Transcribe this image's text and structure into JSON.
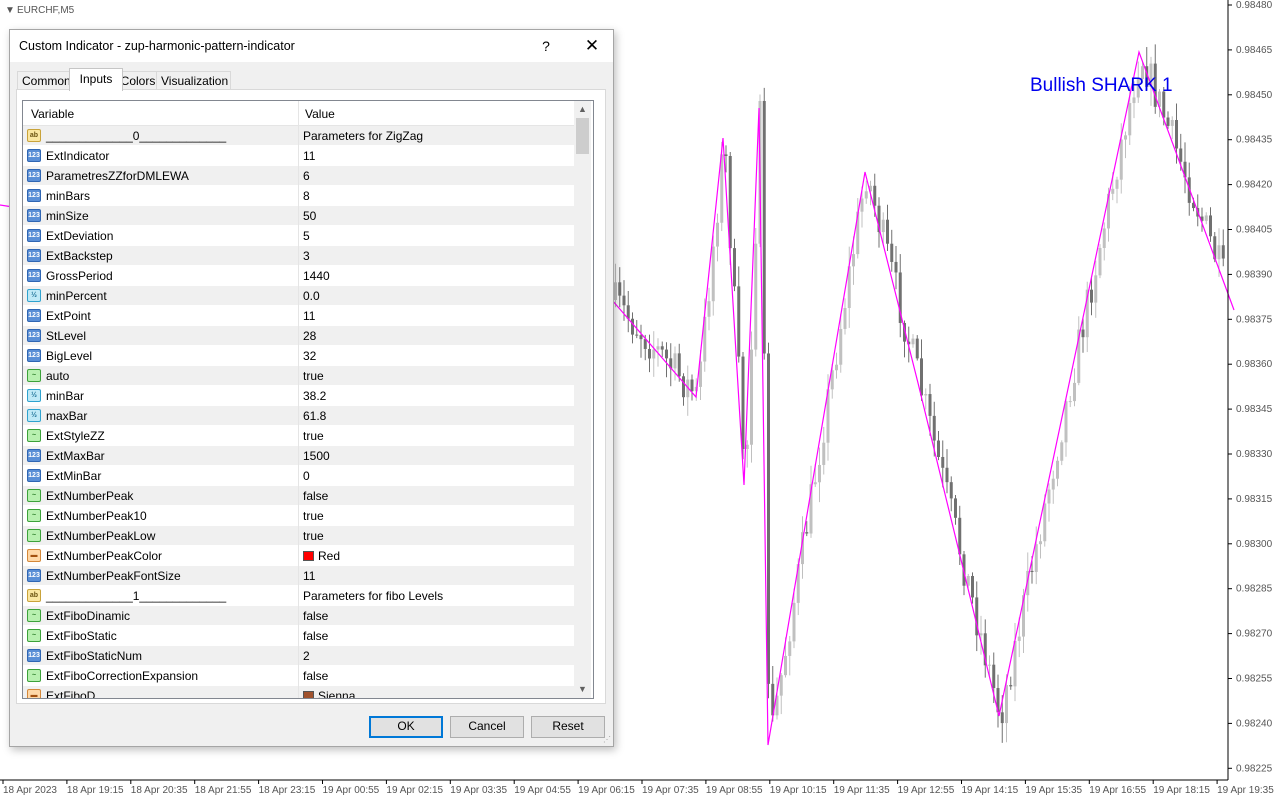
{
  "chart": {
    "symbol_label": "EURCHF,M5",
    "pattern_label": "Bullish SHARK 1",
    "pattern_color": "#0000ee",
    "zigzag_color": "#ff00ff",
    "candle_up_color": "#c0c0c0",
    "candle_down_color": "#707070",
    "price_labels": [
      "0.98480",
      "0.98465",
      "0.98450",
      "0.98435",
      "0.98420",
      "0.98405",
      "0.98390",
      "0.98375",
      "0.98360",
      "0.98345",
      "0.98330",
      "0.98315",
      "0.98300",
      "0.98285",
      "0.98270",
      "0.98255",
      "0.98240",
      "0.98225"
    ],
    "time_labels": [
      "18 Apr 2023",
      "18 Apr 19:15",
      "18 Apr 20:35",
      "18 Apr 21:55",
      "18 Apr 23:15",
      "19 Apr 00:55",
      "19 Apr 02:15",
      "19 Apr 03:35",
      "19 Apr 04:55",
      "19 Apr 06:15",
      "19 Apr 07:35",
      "19 Apr 08:55",
      "19 Apr 10:15",
      "19 Apr 11:35",
      "19 Apr 12:55",
      "19 Apr 14:15",
      "19 Apr 15:35",
      "19 Apr 16:55",
      "19 Apr 18:15",
      "19 Apr 19:35"
    ]
  },
  "dialog": {
    "title": "Custom Indicator - zup-harmonic-pattern-indicator",
    "help": "?",
    "close": "✕",
    "tabs": [
      "Common",
      "Inputs",
      "Colors",
      "Visualization"
    ],
    "active_tab": "Inputs",
    "columns": {
      "variable": "Variable",
      "value": "Value"
    },
    "rows": [
      {
        "icon": "str",
        "tag": "ab",
        "name": "_____________0_____________",
        "value": "Parameters for ZigZag"
      },
      {
        "icon": "int",
        "tag": "123",
        "name": "ExtIndicator",
        "value": "11"
      },
      {
        "icon": "int",
        "tag": "123",
        "name": "ParametresZZforDMLEWA",
        "value": "6"
      },
      {
        "icon": "int",
        "tag": "123",
        "name": "minBars",
        "value": "8"
      },
      {
        "icon": "int",
        "tag": "123",
        "name": "minSize",
        "value": "50"
      },
      {
        "icon": "int",
        "tag": "123",
        "name": "ExtDeviation",
        "value": "5"
      },
      {
        "icon": "int",
        "tag": "123",
        "name": "ExtBackstep",
        "value": "3"
      },
      {
        "icon": "int",
        "tag": "123",
        "name": "GrossPeriod",
        "value": "1440"
      },
      {
        "icon": "dbl",
        "tag": "½",
        "name": "minPercent",
        "value": "0.0"
      },
      {
        "icon": "int",
        "tag": "123",
        "name": "ExtPoint",
        "value": "11"
      },
      {
        "icon": "int",
        "tag": "123",
        "name": "StLevel",
        "value": "28"
      },
      {
        "icon": "int",
        "tag": "123",
        "name": "BigLevel",
        "value": "32"
      },
      {
        "icon": "bool",
        "tag": "~",
        "name": "auto",
        "value": "true"
      },
      {
        "icon": "dbl",
        "tag": "½",
        "name": "minBar",
        "value": "38.2"
      },
      {
        "icon": "dbl",
        "tag": "½",
        "name": "maxBar",
        "value": "61.8"
      },
      {
        "icon": "bool",
        "tag": "~",
        "name": "ExtStyleZZ",
        "value": "true"
      },
      {
        "icon": "int",
        "tag": "123",
        "name": "ExtMaxBar",
        "value": "1500"
      },
      {
        "icon": "int",
        "tag": "123",
        "name": "ExtMinBar",
        "value": "0"
      },
      {
        "icon": "bool",
        "tag": "~",
        "name": "ExtNumberPeak",
        "value": "false"
      },
      {
        "icon": "bool",
        "tag": "~",
        "name": "ExtNumberPeak10",
        "value": "true"
      },
      {
        "icon": "bool",
        "tag": "~",
        "name": "ExtNumberPeakLow",
        "value": "true"
      },
      {
        "icon": "clr",
        "tag": "▬",
        "name": "ExtNumberPeakColor",
        "value": "Red",
        "swatch": "#ff0000"
      },
      {
        "icon": "int",
        "tag": "123",
        "name": "ExtNumberPeakFontSize",
        "value": "11"
      },
      {
        "icon": "str",
        "tag": "ab",
        "name": "_____________1_____________",
        "value": "Parameters for fibo Levels"
      },
      {
        "icon": "bool",
        "tag": "~",
        "name": "ExtFiboDinamic",
        "value": "false"
      },
      {
        "icon": "bool",
        "tag": "~",
        "name": "ExtFiboStatic",
        "value": "false"
      },
      {
        "icon": "int",
        "tag": "123",
        "name": "ExtFiboStaticNum",
        "value": "2"
      },
      {
        "icon": "bool",
        "tag": "~",
        "name": "ExtFiboCorrectionExpansion",
        "value": "false"
      },
      {
        "icon": "clr",
        "tag": "▬",
        "name": "ExtFiboD",
        "value": "Sienna",
        "swatch": "#a0522d"
      }
    ],
    "buttons": {
      "ok": "OK",
      "cancel": "Cancel",
      "reset": "Reset"
    }
  }
}
